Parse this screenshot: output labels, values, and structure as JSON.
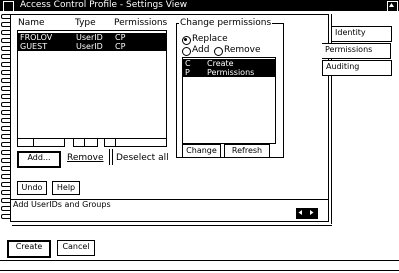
{
  "window": {
    "title": "Access Control Profile - Settings View",
    "system_menu_icon": "system-menu-icon",
    "scroll_up_icon": "arrow-up-icon"
  },
  "columns": [
    "Name",
    "Type",
    "Permissions"
  ],
  "rows": [
    {
      "name": "FROLOV",
      "type": "UserID",
      "permissions": "CP"
    },
    {
      "name": "GUEST",
      "type": "UserID",
      "permissions": "CP"
    }
  ],
  "list_buttons": {
    "add": "Add...",
    "remove": "Remove",
    "deselect_all": "Deselect all"
  },
  "bottom_buttons": {
    "undo": "Undo",
    "help": "Help"
  },
  "status_text": "Add UserIDs and Groups",
  "change_permissions": {
    "title": "Change permissions",
    "options": {
      "replace": "Replace",
      "add": "Add",
      "remove": "Remove"
    },
    "selected_option": "replace",
    "perms": [
      {
        "code": "C",
        "label": "Create"
      },
      {
        "code": "P",
        "label": "Permissions"
      }
    ],
    "change_button": "Change",
    "refresh_button": "Refresh"
  },
  "tabs": [
    "Identity",
    "Permissions",
    "Auditing"
  ],
  "active_tab": "Permissions",
  "page_nav_icons": [
    "arrow-left-icon",
    "arrow-right-icon"
  ],
  "dialog_buttons": {
    "create": "Create",
    "cancel": "Cancel"
  }
}
